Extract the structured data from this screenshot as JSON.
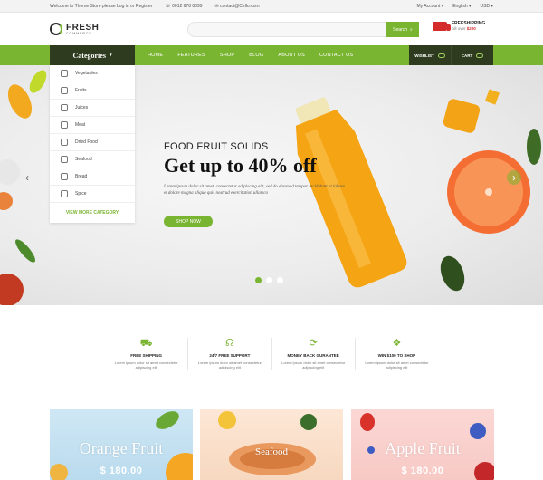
{
  "topbar": {
    "welcome": "Welcome to Theme Store please Log in or Register",
    "phone": "0012 678 8899",
    "email": "contact@Cello.com",
    "account": "My Account",
    "language": "English",
    "currency": "USD"
  },
  "logo": {
    "name": "FRESH",
    "tagline": "COMMERCE"
  },
  "search": {
    "placeholder": "",
    "button": "Search"
  },
  "shipping": {
    "title": "FREESHIPPING",
    "text": "bill over",
    "amount": "$200"
  },
  "nav": {
    "categories_label": "Categories",
    "menu": [
      "HOME",
      "FEATURES",
      "SHOP",
      "BLOG",
      "ABOUT US",
      "CONTACT US"
    ],
    "wishlist": "WISHLIST",
    "cart": "CART"
  },
  "categories": {
    "items": [
      "Vegetables",
      "Fruits",
      "Juices",
      "Meat",
      "Dried Food",
      "Seafood",
      "Bread",
      "Spice"
    ],
    "more": "VIEW MORE CATEGORY"
  },
  "hero": {
    "subtitle": "FOOD FRUIT SOLIDS",
    "title": "Get up to 40% off",
    "description": "Lorem ipsum dolor sit amet, consectetur adipiscing elit, sed do eiusmod tempor incididunt ut labore et dolore magna aliqua quis nostrud exercitation ullamco",
    "button": "SHOP NOW",
    "active_slide": 1,
    "slide_count": 3
  },
  "features": [
    {
      "icon": "truck-icon",
      "title": "FREE SHIPPING",
      "desc": "Lorem ipsum dolor sit amet consectetur adipiscing elit"
    },
    {
      "icon": "headset-icon",
      "title": "24/7 FREE SUPPORT",
      "desc": "Lorem ipsum dolor sit amet consectetur adipiscing elit"
    },
    {
      "icon": "money-back-icon",
      "title": "MONEY BACK GURANTEE",
      "desc": "Lorem ipsum dolor sit amet consectetur adipiscing elit"
    },
    {
      "icon": "gift-icon",
      "title": "WIN $100 TO SHOP",
      "desc": "Lorem ipsum dolor sit amet consectetur adipiscing elit"
    }
  ],
  "banners": [
    {
      "title": "Orange Fruit",
      "price": "$ 180.00"
    },
    {
      "title": "Seafood",
      "price": ""
    },
    {
      "title": "Apple Fruit",
      "price": "$ 180.00"
    }
  ],
  "colors": {
    "accent": "#7ab532",
    "dark": "#2f3b1f",
    "sale": "#d42b2b"
  }
}
